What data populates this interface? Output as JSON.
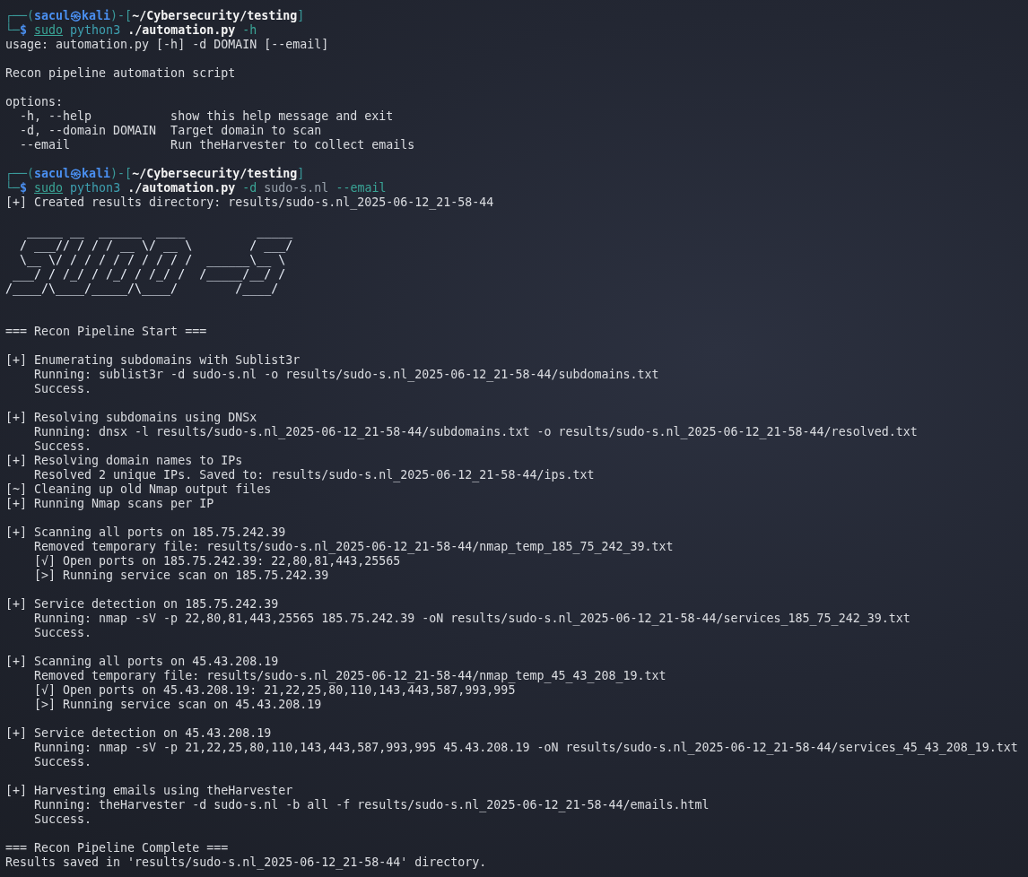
{
  "terminal": {
    "lines": [
      {
        "kind": "prompt",
        "frame_open": "┌──(",
        "user": "sacul",
        "at": "㉿",
        "host": "kali",
        "frame_mid": ")-[",
        "path": "~/Cybersecurity/testing",
        "frame_close": "]"
      },
      {
        "kind": "command",
        "corner": "└─",
        "symbol": "$",
        "tokens": [
          {
            "text": "sudo",
            "kind": "sudo"
          },
          {
            "text": "python3",
            "kind": "program"
          },
          {
            "text": "./automation.py",
            "kind": "script"
          },
          {
            "text": "-h",
            "kind": "flag"
          }
        ]
      },
      {
        "kind": "output",
        "text": "usage: automation.py [-h] -d DOMAIN [--email]"
      },
      {
        "kind": "spacer"
      },
      {
        "kind": "output",
        "text": "Recon pipeline automation script"
      },
      {
        "kind": "spacer"
      },
      {
        "kind": "output",
        "text": "options:"
      },
      {
        "kind": "output",
        "text": "  -h, --help           show this help message and exit"
      },
      {
        "kind": "output",
        "text": "  -d, --domain DOMAIN  Target domain to scan"
      },
      {
        "kind": "output",
        "text": "  --email              Run theHarvester to collect emails"
      },
      {
        "kind": "spacer"
      },
      {
        "kind": "prompt",
        "frame_open": "┌──(",
        "user": "sacul",
        "at": "㉿",
        "host": "kali",
        "frame_mid": ")-[",
        "path": "~/Cybersecurity/testing",
        "frame_close": "]"
      },
      {
        "kind": "command",
        "corner": "└─",
        "symbol": "$",
        "tokens": [
          {
            "text": "sudo",
            "kind": "sudo"
          },
          {
            "text": "python3",
            "kind": "program"
          },
          {
            "text": "./automation.py",
            "kind": "script"
          },
          {
            "text": "-d",
            "kind": "flag"
          },
          {
            "text": "sudo-s.nl",
            "kind": "value"
          },
          {
            "text": "--email",
            "kind": "flag"
          }
        ]
      },
      {
        "kind": "output",
        "text": "[+] Created results directory: results/sudo-s.nl_2025-06-12_21-58-44"
      },
      {
        "kind": "spacer"
      },
      {
        "kind": "art",
        "rows": [
          "   _____ __  ______  ____          _____",
          "  / ___// / / / __ \\/ __ \\        / ___/",
          "  \\__ \\/ / / / / / / / / /  ______\\__ \\ ",
          " ___/ / /_/ / /_/ / /_/ /  /_____/__/ / ",
          "/____/\\____/_____/\\____/        /____/  "
        ]
      },
      {
        "kind": "spacer"
      },
      {
        "kind": "spacer"
      },
      {
        "kind": "output",
        "text": "=== Recon Pipeline Start ==="
      },
      {
        "kind": "spacer"
      },
      {
        "kind": "output",
        "text": "[+] Enumerating subdomains with Sublist3r"
      },
      {
        "kind": "output",
        "text": "    Running: sublist3r -d sudo-s.nl -o results/sudo-s.nl_2025-06-12_21-58-44/subdomains.txt"
      },
      {
        "kind": "output",
        "text": "    Success."
      },
      {
        "kind": "spacer"
      },
      {
        "kind": "output",
        "text": "[+] Resolving subdomains using DNSx"
      },
      {
        "kind": "output",
        "text": "    Running: dnsx -l results/sudo-s.nl_2025-06-12_21-58-44/subdomains.txt -o results/sudo-s.nl_2025-06-12_21-58-44/resolved.txt"
      },
      {
        "kind": "output",
        "text": "    Success."
      },
      {
        "kind": "output",
        "text": "[+] Resolving domain names to IPs"
      },
      {
        "kind": "output",
        "text": "    Resolved 2 unique IPs. Saved to: results/sudo-s.nl_2025-06-12_21-58-44/ips.txt"
      },
      {
        "kind": "output",
        "text": "[~] Cleaning up old Nmap output files"
      },
      {
        "kind": "output",
        "text": "[+] Running Nmap scans per IP"
      },
      {
        "kind": "spacer"
      },
      {
        "kind": "output",
        "text": "[+] Scanning all ports on 185.75.242.39"
      },
      {
        "kind": "output",
        "text": "    Removed temporary file: results/sudo-s.nl_2025-06-12_21-58-44/nmap_temp_185_75_242_39.txt"
      },
      {
        "kind": "output",
        "text": "    [√] Open ports on 185.75.242.39: 22,80,81,443,25565"
      },
      {
        "kind": "output",
        "text": "    [>] Running service scan on 185.75.242.39"
      },
      {
        "kind": "spacer"
      },
      {
        "kind": "output",
        "text": "[+] Service detection on 185.75.242.39"
      },
      {
        "kind": "output",
        "text": "    Running: nmap -sV -p 22,80,81,443,25565 185.75.242.39 -oN results/sudo-s.nl_2025-06-12_21-58-44/services_185_75_242_39.txt"
      },
      {
        "kind": "output",
        "text": "    Success."
      },
      {
        "kind": "spacer"
      },
      {
        "kind": "output",
        "text": "[+] Scanning all ports on 45.43.208.19"
      },
      {
        "kind": "output",
        "text": "    Removed temporary file: results/sudo-s.nl_2025-06-12_21-58-44/nmap_temp_45_43_208_19.txt"
      },
      {
        "kind": "output",
        "text": "    [√] Open ports on 45.43.208.19: 21,22,25,80,110,143,443,587,993,995"
      },
      {
        "kind": "output",
        "text": "    [>] Running service scan on 45.43.208.19"
      },
      {
        "kind": "spacer"
      },
      {
        "kind": "output",
        "text": "[+] Service detection on 45.43.208.19"
      },
      {
        "kind": "output",
        "text": "    Running: nmap -sV -p 21,22,25,80,110,143,443,587,993,995 45.43.208.19 -oN results/sudo-s.nl_2025-06-12_21-58-44/services_45_43_208_19.txt"
      },
      {
        "kind": "output",
        "text": "    Success."
      },
      {
        "kind": "spacer"
      },
      {
        "kind": "output",
        "text": "[+] Harvesting emails using theHarvester"
      },
      {
        "kind": "output",
        "text": "    Running: theHarvester -d sudo-s.nl -b all -f results/sudo-s.nl_2025-06-12_21-58-44/emails.html"
      },
      {
        "kind": "output",
        "text": "    Success."
      },
      {
        "kind": "spacer"
      },
      {
        "kind": "output",
        "text": "=== Recon Pipeline Complete ==="
      },
      {
        "kind": "output",
        "text": "Results saved in 'results/sudo-s.nl_2025-06-12_21-58-44' directory."
      }
    ]
  }
}
